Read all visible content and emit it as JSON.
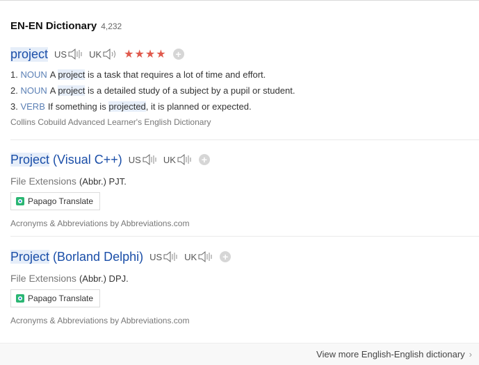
{
  "header": {
    "title": "EN-EN Dictionary",
    "count": "4,232"
  },
  "entry1": {
    "word": "project",
    "us": "US",
    "uk": "UK",
    "stars": "★★★★",
    "plus": "+",
    "defs": [
      {
        "num": "1.",
        "pos": "NOUN",
        "pre": "A ",
        "hl": "project",
        "post": " is a task that requires a lot of time and effort."
      },
      {
        "num": "2.",
        "pos": "NOUN",
        "pre": "A ",
        "hl": "project",
        "post": " is a detailed study of a subject by a pupil or student."
      },
      {
        "num": "3.",
        "pos": "VERB",
        "pre": "If something is ",
        "hl": "projected",
        "post": ", it is planned or expected."
      }
    ],
    "source": "Collins Cobuild Advanced Learner's English Dictionary"
  },
  "entry2": {
    "word_hl": "Project",
    "word_rest": " (Visual C++)",
    "us": "US",
    "uk": "UK",
    "plus": "+",
    "category": "File Extensions",
    "value": "(Abbr.) PJT.",
    "papago": "Papago Translate",
    "source": "Acronyms & Abbreviations by Abbreviations.com"
  },
  "entry3": {
    "word_hl": "Project",
    "word_rest": " (Borland Delphi)",
    "us": "US",
    "uk": "UK",
    "plus": "+",
    "category": "File Extensions",
    "value": "(Abbr.) DPJ.",
    "papago": "Papago Translate",
    "source": "Acronyms & Abbreviations by Abbreviations.com"
  },
  "footer": {
    "more": "View more English-English dictionary",
    "chev": "›"
  }
}
